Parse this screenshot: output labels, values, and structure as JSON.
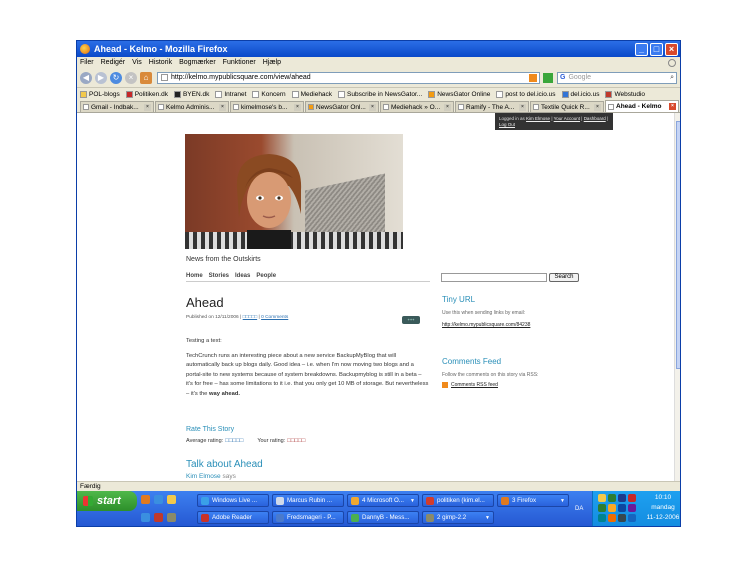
{
  "window": {
    "title": "Ahead - Kelmo - Mozilla Firefox"
  },
  "menu": [
    "Filer",
    "Redigér",
    "Vis",
    "Historik",
    "Bogmærker",
    "Funktioner",
    "Hjælp"
  ],
  "nav": {
    "url": "http://kelmo.mypublicsquare.com/view/ahead",
    "search_placeholder": "Google"
  },
  "bookmarks": [
    "POL-blogs",
    "Politiken.dk",
    "BYEN.dk",
    "Intranet",
    "Koncern",
    "Mediehack",
    "Subscribe in NewsGator...",
    "NewsGator Online",
    "post to del.icio.us",
    "del.icio.us",
    "Webstudio"
  ],
  "tabs": [
    {
      "label": "Gmail - Indbak...",
      "active": false
    },
    {
      "label": "Kelmo Adminis...",
      "active": false
    },
    {
      "label": "kimelmose's b...",
      "active": false
    },
    {
      "label": "NewsGator Onl...",
      "active": false
    },
    {
      "label": "Mediehack » O...",
      "active": false
    },
    {
      "label": "Ramify - The A...",
      "active": false
    },
    {
      "label": "Textile Quick R...",
      "active": false
    },
    {
      "label": "Ahead - Kelmo",
      "active": true
    }
  ],
  "userbar": {
    "prefix": "Logged in as",
    "user": "Kim Elmose",
    "account": "Your Account",
    "dashboard": "Dashboard",
    "logout": "Log Out"
  },
  "site": {
    "tagline": "News from the Outskirts",
    "nav": [
      "Home",
      "Stories",
      "Ideas",
      "People"
    ],
    "search_button": "Search"
  },
  "post": {
    "title": "Ahead",
    "published": "Published on 12/11/2006",
    "tags_link": "□□□□□",
    "comments_link": "0 Comments",
    "share": "+++",
    "para1": "Testing a text:",
    "para2": "TechCrunch runs an interesting piece about a new service BackupMyBlog that will automatically back up blogs daily. Good idea – i.e. when I'm now moving two blogs and a portal-site to new systems because of system breakdowns. Backupmyblog is still in a beta – it's for free – has some limitations to it i.e. that you only get 10 MB of storage. But nevertheless – it's the",
    "para2_bold": "way ahead."
  },
  "rating": {
    "title": "Rate This Story",
    "average_label": "Average rating:",
    "your_label": "Your rating:",
    "average_value": 0,
    "your_value": 0,
    "stars_max": 5,
    "stars": "□□□□□"
  },
  "comments": {
    "title": "Talk about Ahead",
    "author": "Kim Elmose",
    "says": "says"
  },
  "sidebar": {
    "tiny_title": "Tiny URL",
    "tiny_text": "Use this when sending links by email:",
    "tiny_link": "http://kelmo.mypublicsquare.com/84238",
    "feed_title": "Comments Feed",
    "feed_text": "Follow the comments on this story via RSS:",
    "feed_link": "Comments RSS feed"
  },
  "status": "Færdig",
  "taskbar": {
    "start": "start",
    "row1": [
      {
        "label": "Windows Live ...",
        "color": "#3aa0e8"
      },
      {
        "label": "Marcus Rubin ...",
        "color": "#cfd9ea"
      },
      {
        "label": "4 Microsoft O...",
        "color": "#f0a830"
      },
      {
        "label": "politiken (kim.el...",
        "color": "#d23c2c"
      },
      {
        "label": "3 Firefox",
        "color": "#e07a20"
      }
    ],
    "row2": [
      {
        "label": "Adobe Reader",
        "color": "#c83228"
      },
      {
        "label": "Fredsmageri - P...",
        "color": "#4a7acc"
      },
      {
        "label": "DannyB - Mess...",
        "color": "#4caf50"
      },
      {
        "label": "2 gimp-2.2",
        "color": "#8a8a6a"
      }
    ],
    "lang": "DA",
    "clock_time": "10:10",
    "clock_day": "mandag",
    "clock_date": "11-12-2006"
  }
}
